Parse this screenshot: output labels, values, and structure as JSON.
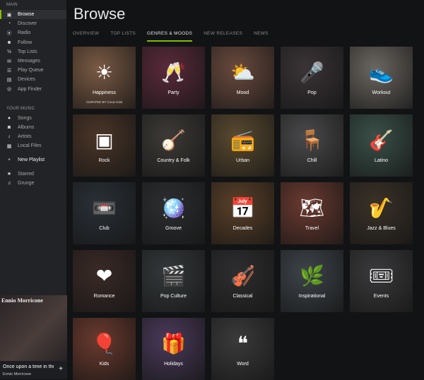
{
  "sidebar": {
    "main_heading": "MAIN",
    "main_items": [
      {
        "label": "Browse",
        "icon": "browse-icon",
        "glyph": "▣",
        "active": true
      },
      {
        "label": "Discover",
        "icon": "discover-icon",
        "glyph": "◔"
      },
      {
        "label": "Radio",
        "icon": "radio-icon",
        "glyph": "⦿"
      },
      {
        "label": "Follow",
        "icon": "follow-icon",
        "glyph": "☻"
      },
      {
        "label": "Top Lists",
        "icon": "top-lists-icon",
        "glyph": "½"
      },
      {
        "label": "Messages",
        "icon": "messages-icon",
        "glyph": "✉"
      },
      {
        "label": "Play Queue",
        "icon": "play-queue-icon",
        "glyph": "☰"
      },
      {
        "label": "Devices",
        "icon": "devices-icon",
        "glyph": "▤"
      },
      {
        "label": "App Finder",
        "icon": "app-finder-icon",
        "glyph": "◎"
      }
    ],
    "music_heading": "YOUR MUSIC",
    "music_items": [
      {
        "label": "Songs",
        "icon": "songs-icon",
        "glyph": "●"
      },
      {
        "label": "Albums",
        "icon": "albums-icon",
        "glyph": "◙"
      },
      {
        "label": "Artists",
        "icon": "artists-icon",
        "glyph": "♪"
      },
      {
        "label": "Local Files",
        "icon": "local-files-icon",
        "glyph": "▦"
      }
    ],
    "new_playlist": "New Playlist",
    "playlists": [
      {
        "label": "Starred",
        "icon": "star-icon",
        "glyph": "★"
      },
      {
        "label": "Grunge",
        "icon": "playlist-icon",
        "glyph": "♫"
      }
    ]
  },
  "now_playing": {
    "art_text": "Ennio Morricone",
    "track": "Once upon a time in the West",
    "artist": "Ennio Morricone"
  },
  "browse": {
    "title": "Browse",
    "tabs": [
      {
        "label": "OVERVIEW"
      },
      {
        "label": "TOP LISTS"
      },
      {
        "label": "GENRES & MOODS",
        "active": true
      },
      {
        "label": "NEW RELEASES"
      },
      {
        "label": "NEWS"
      }
    ],
    "tiles": [
      {
        "label": "Happiness",
        "glyph": "☀",
        "bg": "#7a5a44",
        "curated": "CURATED BY Coca-Cola"
      },
      {
        "label": "Party",
        "glyph": "🥂",
        "bg": "#5a2a3a"
      },
      {
        "label": "Mood",
        "glyph": "⛅",
        "bg": "#6a4a3e"
      },
      {
        "label": "Pop",
        "glyph": "🎤",
        "bg": "#3a3436"
      },
      {
        "label": "Workout",
        "glyph": "👟",
        "bg": "#6b6660"
      },
      {
        "label": "Rock",
        "glyph": "▣",
        "bg": "#4a3528"
      },
      {
        "label": "Country & Folk",
        "glyph": "🪕",
        "bg": "#3d3a36"
      },
      {
        "label": "Urban",
        "glyph": "📻",
        "bg": "#5a4a30"
      },
      {
        "label": "Chill",
        "glyph": "🪑",
        "bg": "#4a4a4c"
      },
      {
        "label": "Latino",
        "glyph": "🎸",
        "bg": "#3a5048"
      },
      {
        "label": "Club",
        "glyph": "📼",
        "bg": "#2a3036"
      },
      {
        "label": "Groove",
        "glyph": "🪩",
        "bg": "#2c2e30"
      },
      {
        "label": "Decades",
        "glyph": "📅",
        "bg": "#5a4028"
      },
      {
        "label": "Travel",
        "glyph": "🗺",
        "bg": "#6a3a30"
      },
      {
        "label": "Jazz & Blues",
        "glyph": "🎷",
        "bg": "#3a3228"
      },
      {
        "label": "Romance",
        "glyph": "❤",
        "bg": "#3a2a26"
      },
      {
        "label": "Pop Culture",
        "glyph": "🎬",
        "bg": "#34383a"
      },
      {
        "label": "Classical",
        "glyph": "🎻",
        "bg": "#2e2e30"
      },
      {
        "label": "Inspirational",
        "glyph": "🌿",
        "bg": "#3e444a"
      },
      {
        "label": "Events",
        "glyph": "🎟",
        "bg": "#3a3a3c"
      },
      {
        "label": "Kids",
        "glyph": "🎈",
        "bg": "#6a3a2e"
      },
      {
        "label": "Holidays",
        "glyph": "🎁",
        "bg": "#4a3a5a"
      },
      {
        "label": "Word",
        "glyph": "❝",
        "bg": "#3a3a3a"
      }
    ]
  }
}
